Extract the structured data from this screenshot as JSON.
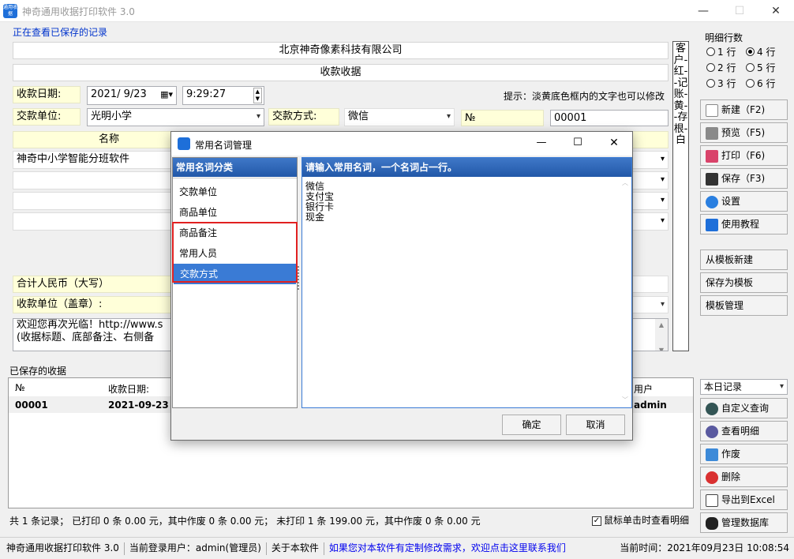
{
  "window": {
    "title": "神奇通用收据打印软件 3.0",
    "icon_text": "通用收据",
    "minimize": "—",
    "maximize": "☐",
    "close": "✕"
  },
  "viewing_label": "正在查看已保存的记录",
  "company": "北京神奇像素科技有限公司",
  "doc_title": "收款收据",
  "form": {
    "date_label": "收款日期:",
    "date_value": "2021/ 9/23",
    "time_value": "9:29:27",
    "hint": "提示：淡黄底色框内的文字也可以修改",
    "payer_label": "交款单位:",
    "payer_value": "光明小学",
    "method_label": "交款方式:",
    "method_value": "微信",
    "no_label": "№",
    "no_value": "00001",
    "name_header": "名称",
    "item1": "神奇中小学智能分班软件",
    "total_label": "合计人民币（大写）",
    "payee_label": "收款单位（盖章）:",
    "remark_line1": "欢迎您再次光临！http://www.s",
    "remark_line2": "(收据标题、底部备注、右侧备"
  },
  "copy_note": "客户-红--记账-黄--存根-白",
  "rows": {
    "title": "明细行数",
    "opts": [
      "1 行",
      "4 行",
      "2 行",
      "5 行",
      "3 行",
      "6 行"
    ],
    "selected": "4 行"
  },
  "buttons": {
    "new": "新建（F2)",
    "preview": "预览（F5)",
    "print": "打印（F6)",
    "save": "保存（F3)",
    "settings": "设置",
    "tutorial": "使用教程",
    "from_template": "从模板新建",
    "save_template": "保存为模板",
    "template_mgr": "模板管理",
    "range": "本日记录",
    "custom_query": "自定义查询",
    "view_detail": "查看明细",
    "void": "作废",
    "delete": "删除",
    "export": "导出到Excel",
    "db": "管理数据库"
  },
  "saved": {
    "title": "已保存的收据",
    "cols": [
      "№",
      "收款日期:",
      "用户"
    ],
    "row": [
      "00001",
      "2021-09-23",
      "admin"
    ]
  },
  "summary": "共 1 条记录；   已打印 0 条 0.00 元，其中作废 0 条 0.00 元；   未打印 1 条 199.00 元，其中作废 0 条 0.00 元",
  "click_detail": "鼠标单击时查看明细",
  "status": {
    "app": "神奇通用收据打印软件 3.0",
    "user": "当前登录用户：admin(管理员)",
    "about": "关于本软件",
    "link": "如果您对本软件有定制修改需求，欢迎点击这里联系我们",
    "time": "当前时间：2021年09月23日 10:08:54"
  },
  "dialog": {
    "title": "常用名词管理",
    "left_header": "常用名词分类",
    "right_header": "请输入常用名词，一个名词占一行。",
    "categories": [
      "交款单位",
      "商品单位",
      "商品备注",
      "常用人员",
      "交款方式"
    ],
    "selected": "交款方式",
    "terms": [
      "微信",
      "支付宝",
      "银行卡",
      "现金"
    ],
    "ok": "确定",
    "cancel": "取消",
    "minimize": "—",
    "maximize": "☐",
    "close": "✕"
  },
  "colors": {
    "accent": "#3a7bd5",
    "highlight_border": "#e02020",
    "link": "#0000ee"
  }
}
